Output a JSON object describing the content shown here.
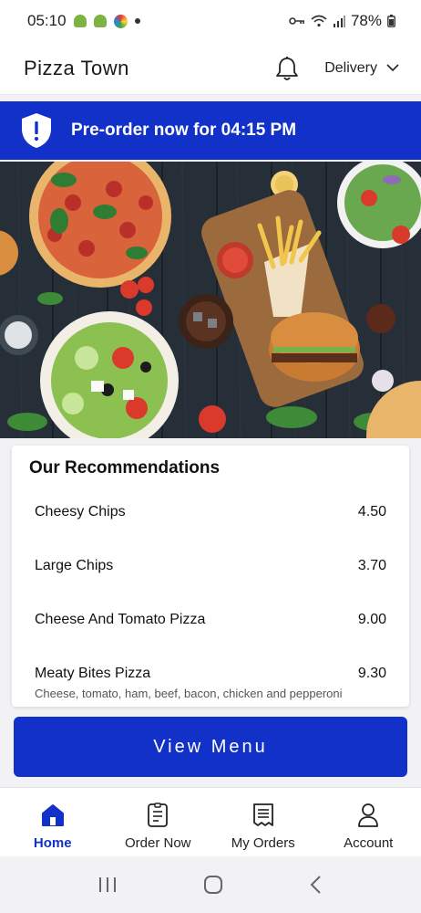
{
  "status_bar": {
    "time": "05:10",
    "battery": "78%"
  },
  "header": {
    "title": "Pizza Town",
    "delivery_label": "Delivery"
  },
  "banner": {
    "text": "Pre-order now for 04:15 PM"
  },
  "recommendations": {
    "title": "Our Recommendations",
    "items": [
      {
        "name": "Cheesy Chips",
        "price": "4.50"
      },
      {
        "name": "Large Chips",
        "price": "3.70"
      },
      {
        "name": "Cheese And Tomato Pizza",
        "price": "9.00"
      },
      {
        "name": "Meaty Bites Pizza",
        "price": "9.30",
        "description": "Cheese, tomato, ham, beef, bacon, chicken and pepperoni"
      }
    ]
  },
  "view_menu_label": "View Menu",
  "bottom_nav": [
    {
      "label": "Home",
      "icon": "home-icon",
      "active": true
    },
    {
      "label": "Order Now",
      "icon": "document-icon",
      "active": false
    },
    {
      "label": "My Orders",
      "icon": "receipt-icon",
      "active": false
    },
    {
      "label": "Account",
      "icon": "user-icon",
      "active": false
    }
  ],
  "colors": {
    "brand_blue": "#1131c8"
  }
}
